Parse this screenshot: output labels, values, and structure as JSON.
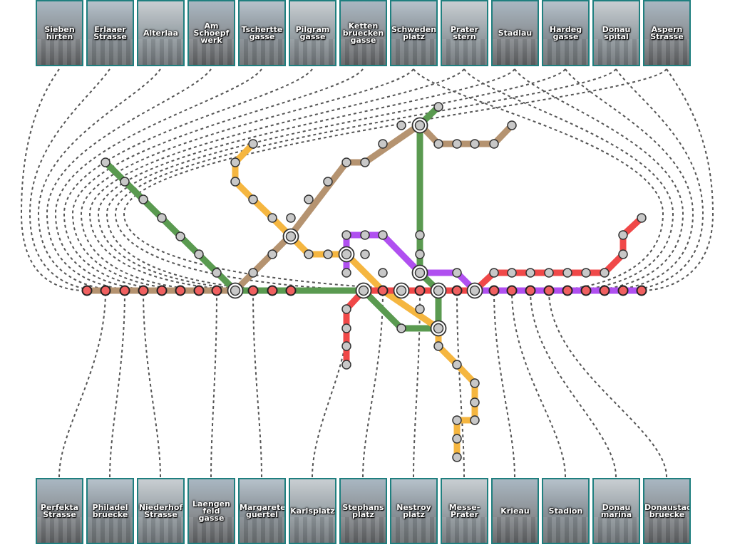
{
  "colors": {
    "green": "#5a9a50",
    "brown": "#b59370",
    "orange": "#f5b640",
    "purple": "#b050f0",
    "red": "#f04848",
    "thumb_border": "#1f7f7f",
    "leader": "#555555"
  },
  "top_stations": [
    {
      "label": "Sieben\nhirten"
    },
    {
      "label": "Erlaaer\nStrasse"
    },
    {
      "label": "Alterlaa"
    },
    {
      "label": "Am\nSchoepf\nwerk"
    },
    {
      "label": "Tschertte\ngasse"
    },
    {
      "label": "Pilgram\ngasse"
    },
    {
      "label": "Ketten\nbruecken\ngasse"
    },
    {
      "label": "Schweden\nplatz"
    },
    {
      "label": "Prater\nstern"
    },
    {
      "label": "Stadlau"
    },
    {
      "label": "Hardeg\ngasse"
    },
    {
      "label": "Donau\nspital"
    },
    {
      "label": "Aspern\nStrasse"
    }
  ],
  "bottom_stations": [
    {
      "label": "Perfekta\nStrasse"
    },
    {
      "label": "Philadel\nbruecke"
    },
    {
      "label": "Niederhof\nStrasse"
    },
    {
      "label": "Laengen\nfeld\ngasse"
    },
    {
      "label": "Margareten\nguertel"
    },
    {
      "label": "Karlsplatz"
    },
    {
      "label": "Stephans\nplatz"
    },
    {
      "label": "Nestroy\nplatz"
    },
    {
      "label": "Messe-\nPrater"
    },
    {
      "label": "Krieau"
    },
    {
      "label": "Stadion"
    },
    {
      "label": "Donau\nmarina"
    },
    {
      "label": "Donaustadt\nbruecke"
    }
  ]
}
